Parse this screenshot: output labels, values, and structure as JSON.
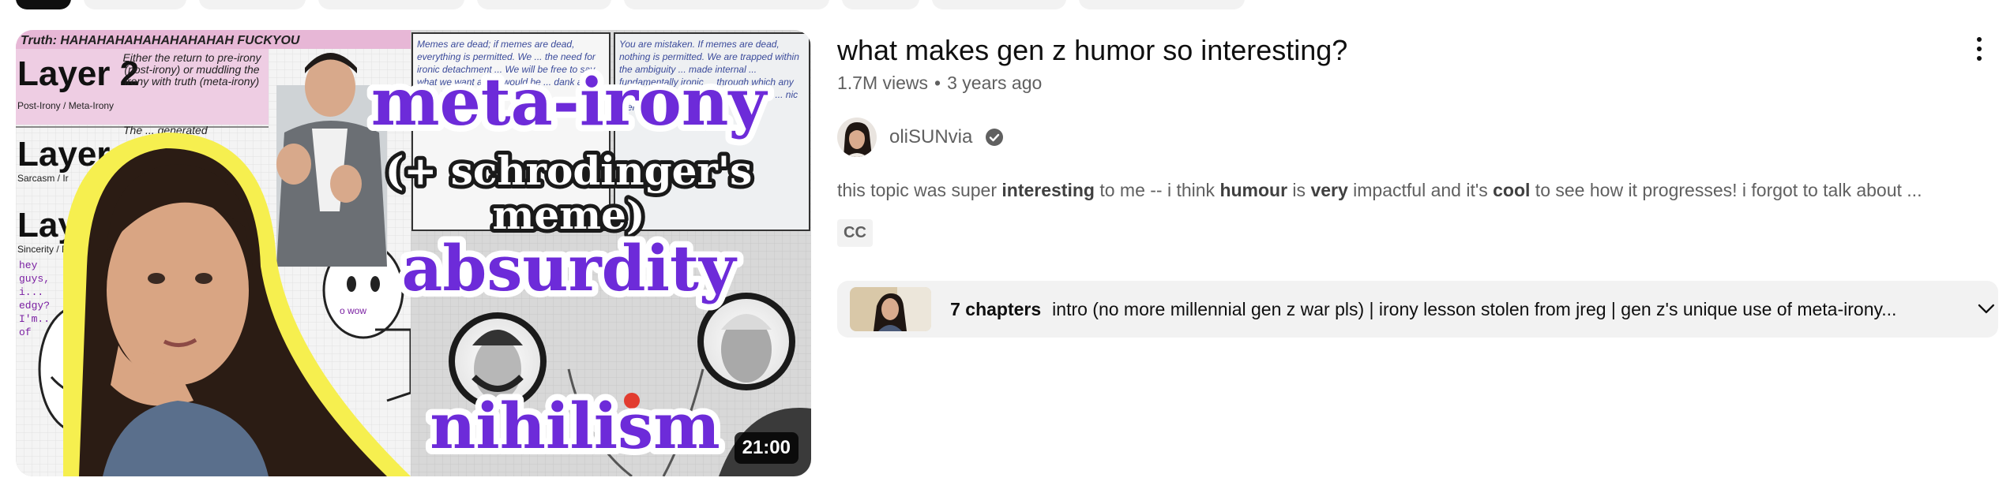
{
  "chips": 9,
  "video": {
    "thumbnail": {
      "texts": {
        "truth": "Truth: HAHAHAHAHAHAHAHAHAH FUCKYOU",
        "layer2": "Layer 2",
        "layer2_note": "Either the return to pre-irony (post-irony) or muddling the irony with truth (meta-irony)",
        "layer2_side": "Post-Irony / Meta-Irony",
        "layer1": "Layer 1",
        "layer1_side": "Sarcasm / Ir",
        "layer1_note": "The ... generated",
        "layer0": "Laye",
        "layer0_side": "Sincerity / P",
        "speech": "hey guys, i... edgy? I'm... of /r/m... rite?",
        "wow": "o wow",
        "big1": "meta-irony",
        "big2": "(+ schrodinger's",
        "big3": "meme)",
        "big4": "absurdity",
        "big5": "nihilism",
        "panel_left": "Memes are dead; if memes are dead, everything is permitted. We ... the need for ironic detachment ... We will be free to say what we want and it would be ... dank as if it were behind ...",
        "panel_right": "You are mistaken. If memes are dead, nothing is permitted. We are trapped within the ambiguity ... made internal ... fundamentally ironic ... through which any joke ... and the only possible ... irony ... nic memes."
      },
      "duration": "21:00"
    },
    "title": "what makes gen z humor so interesting?",
    "views": "1.7M views",
    "age": "3 years ago",
    "channel": "oliSUNvia",
    "description": [
      {
        "t": "this topic was super ",
        "b": false
      },
      {
        "t": "interesting",
        "b": true
      },
      {
        "t": " to me -- i think ",
        "b": false
      },
      {
        "t": "humour",
        "b": true
      },
      {
        "t": " is ",
        "b": false
      },
      {
        "t": "very",
        "b": true
      },
      {
        "t": " impactful and it's ",
        "b": false
      },
      {
        "t": "cool",
        "b": true
      },
      {
        "t": " to see how it progresses! i forgot to talk about ...",
        "b": false
      }
    ],
    "cc": "CC",
    "chapters": {
      "count": "7 chapters",
      "list": "intro (no more millennial gen z war pls) | irony lesson stolen from jreg | gen z's unique use of meta-irony..."
    }
  },
  "icons": {
    "more": "more-vert-icon",
    "verified": "verified-check-icon",
    "expand": "chevron-down-icon"
  },
  "colors": {
    "purple": "#6d2bd9",
    "secondary_text": "#606060",
    "chip_bg": "#f2f2f2"
  }
}
